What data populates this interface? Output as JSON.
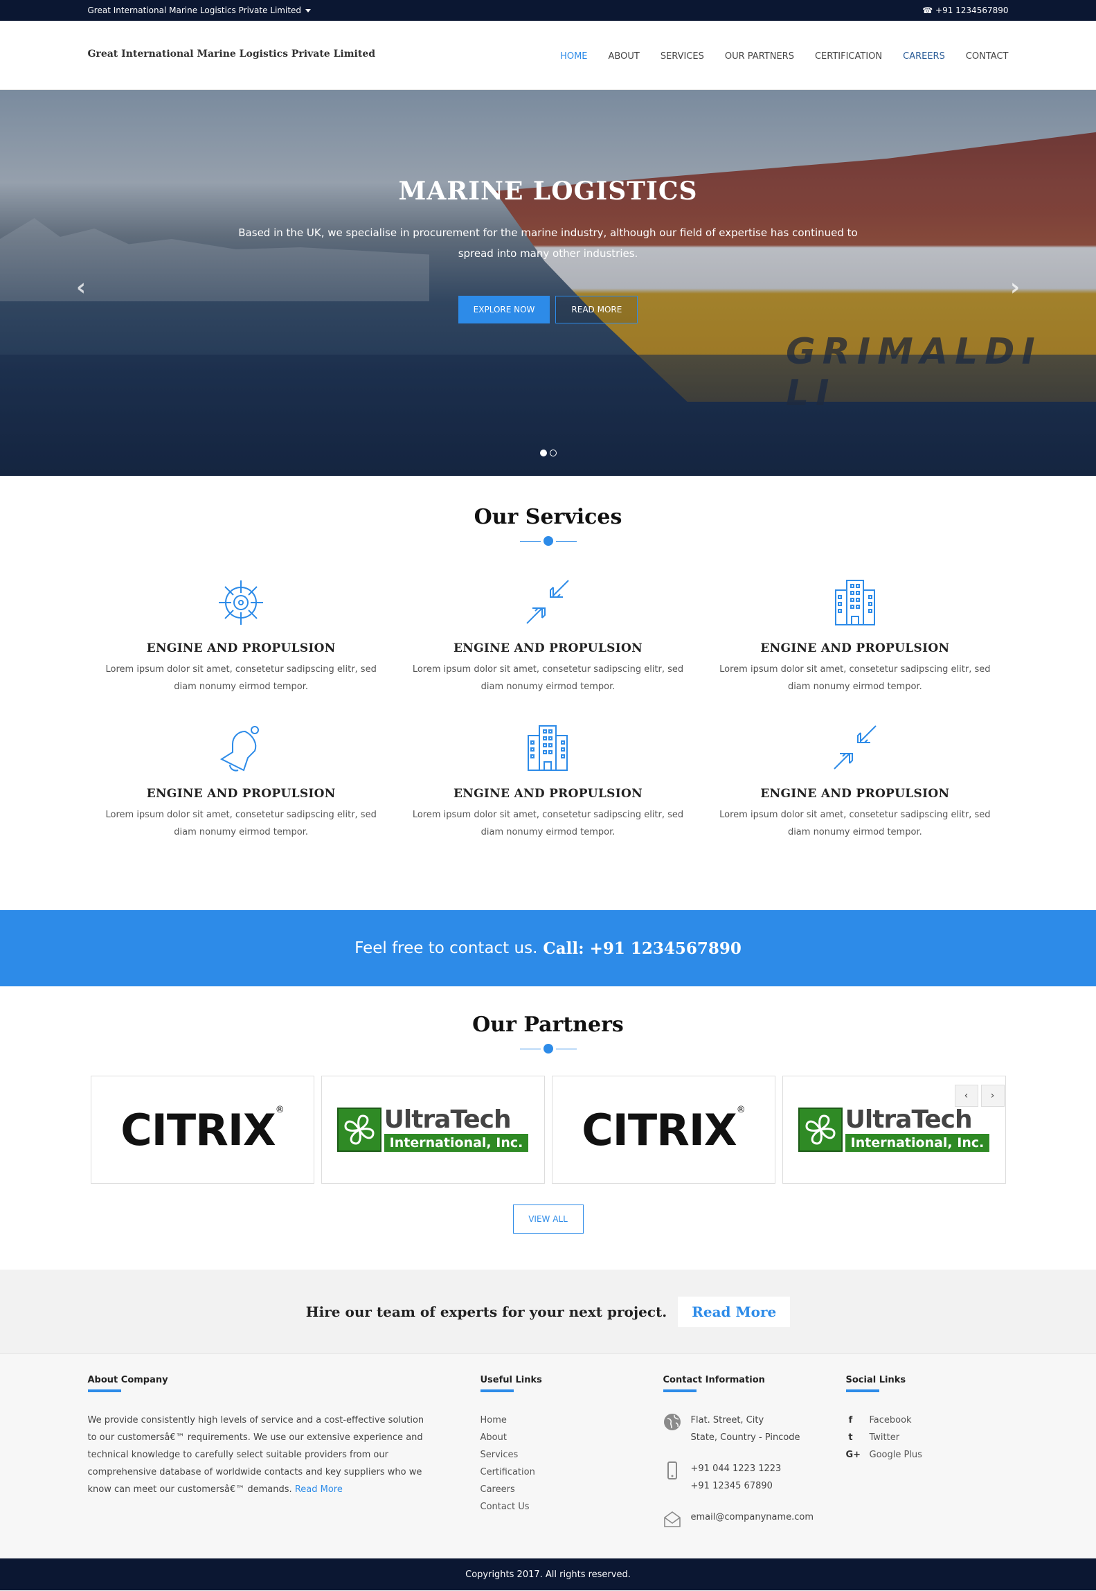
{
  "topbar": {
    "company_dropdown": "Great International Marine Logistics Private Limited",
    "phone": "☎ +91 1234567890"
  },
  "header": {
    "brand": "Great International Marine Logistics Private Limited",
    "nav": [
      "HOME",
      "ABOUT",
      "SERVICES",
      "OUR PARTNERS",
      "CERTIFICATION",
      "CAREERS",
      "CONTACT"
    ]
  },
  "hero": {
    "title": "MARINE LOGISTICS",
    "text": "Based in the UK, we specialise in procurement for the marine industry, although our field of expertise has continued to spread into many other industries.",
    "explore_btn": "EXPLORE NOW",
    "readmore_btn": "READ MORE",
    "ship_text": "GRIMALDI LI",
    "prev": "‹",
    "next": "›"
  },
  "services": {
    "title": "Our Services",
    "items": [
      {
        "icon": "helm-icon",
        "title": "ENGINE AND PROPULSION",
        "text": "Lorem ipsum dolor sit amet, consetetur sadipscing elitr, sed diam nonumy eirmod tempor."
      },
      {
        "icon": "arrows-in-icon",
        "title": "ENGINE AND PROPULSION",
        "text": "Lorem ipsum dolor sit amet, consetetur sadipscing elitr, sed diam nonumy eirmod tempor."
      },
      {
        "icon": "building-icon",
        "title": "ENGINE AND PROPULSION",
        "text": "Lorem ipsum dolor sit amet, consetetur sadipscing elitr, sed diam nonumy eirmod tempor."
      },
      {
        "icon": "bell-icon",
        "title": "ENGINE AND PROPULSION",
        "text": "Lorem ipsum dolor sit amet, consetetur sadipscing elitr, sed diam nonumy eirmod tempor."
      },
      {
        "icon": "building-icon",
        "title": "ENGINE AND PROPULSION",
        "text": "Lorem ipsum dolor sit amet, consetetur sadipscing elitr, sed diam nonumy eirmod tempor."
      },
      {
        "icon": "arrows-in-icon",
        "title": "ENGINE AND PROPULSION",
        "text": "Lorem ipsum dolor sit amet, consetetur sadipscing elitr, sed diam nonumy eirmod tempor."
      }
    ]
  },
  "contact_band": {
    "text": "Feel free to contact us.",
    "call": "Call: +91 1234567890"
  },
  "partners": {
    "title": "Our Partners",
    "prev": "‹",
    "next": "›",
    "logos": [
      {
        "name": "CITRIX"
      },
      {
        "name": "UltraTech",
        "sub": "International, Inc."
      },
      {
        "name": "CITRIX"
      },
      {
        "name": "UltraTech",
        "sub": "International, Inc."
      }
    ],
    "view_all": "VIEW ALL"
  },
  "hire": {
    "text": "Hire our team of experts for your next project.",
    "button": "Read More"
  },
  "footer": {
    "about": {
      "title": "About Company",
      "text": "We provide consistently high levels of service and a cost-effective solution to our customersâ€™ requirements. We use our extensive experience and technical knowledge to carefully select suitable providers from our comprehensive database of worldwide contacts and key suppliers who we know can meet our customersâ€™ demands.",
      "link": "Read More"
    },
    "useful": {
      "title": "Useful Links",
      "items": [
        "Home",
        "About",
        "Services",
        "Certification",
        "Careers",
        "Contact Us"
      ]
    },
    "contact": {
      "title": "Contact Information",
      "address1": "Flat. Street, City",
      "address2": "State, Country - Pincode",
      "phone1": "+91 044 1223 1223",
      "phone2": "+91 12345 67890",
      "email": "email@companyname.com"
    },
    "social": {
      "title": "Social Links",
      "items": [
        {
          "icon": "f",
          "label": "Facebook"
        },
        {
          "icon": "t",
          "label": "Twitter"
        },
        {
          "icon": "G+",
          "label": "Google Plus"
        }
      ]
    },
    "copyright": "Copyrights 2017. All rights reserved."
  },
  "colors": {
    "accent": "#2d8be8",
    "dark": "#0b1732"
  }
}
